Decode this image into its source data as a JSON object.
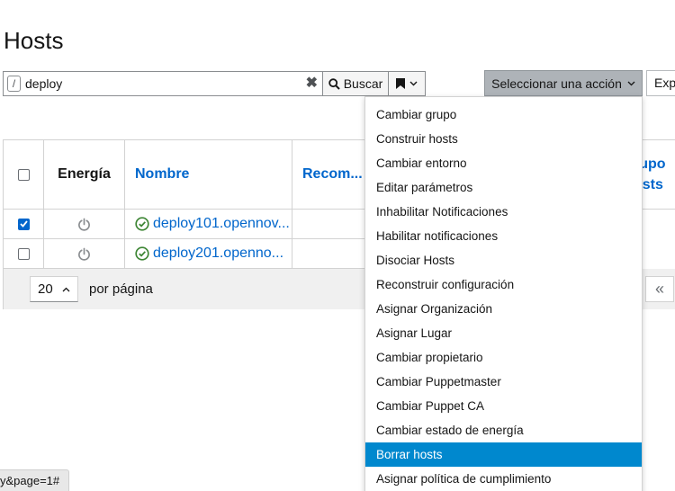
{
  "page": {
    "title": "Hosts"
  },
  "search": {
    "slash_hint": "/",
    "value": "deploy",
    "clear": "✖",
    "button_label": "Buscar"
  },
  "toolbar": {
    "action_label": "Seleccionar una acción",
    "export_label": "Exp"
  },
  "table": {
    "headers": {
      "energy": "Energía",
      "name": "Nombre",
      "recommended": "Recom...",
      "group_line1": "rupo",
      "group_line2": "osts"
    },
    "rows": [
      {
        "checked": true,
        "name": "deploy101.opennov..."
      },
      {
        "checked": false,
        "name": "deploy201.openno..."
      }
    ]
  },
  "pagination": {
    "per_page": "20",
    "per_page_label": "por página",
    "first_page": "«"
  },
  "dropdown": {
    "items": [
      "Cambiar grupo",
      "Construir hosts",
      "Cambiar entorno",
      "Editar parámetros",
      "Inhabilitar Notificaciones",
      "Habilitar notificaciones",
      "Disociar Hosts",
      "Reconstruir configuración",
      "Asignar Organización",
      "Asignar Lugar",
      "Cambiar propietario",
      "Cambiar Puppetmaster",
      "Cambiar Puppet CA",
      "Cambiar estado de energía",
      "Borrar hosts",
      "Asignar política de cumplimiento"
    ],
    "highlighted": "Borrar hosts"
  },
  "status_bar": {
    "url": "y&page=1#"
  },
  "colors": {
    "link": "#0066cc",
    "highlight": "#0088ce",
    "ok": "#3e8635"
  },
  "icons": [
    "search-icon",
    "bookmark-icon",
    "chevron-down-icon",
    "power-icon",
    "check-circle-icon",
    "chevron-up-icon"
  ]
}
